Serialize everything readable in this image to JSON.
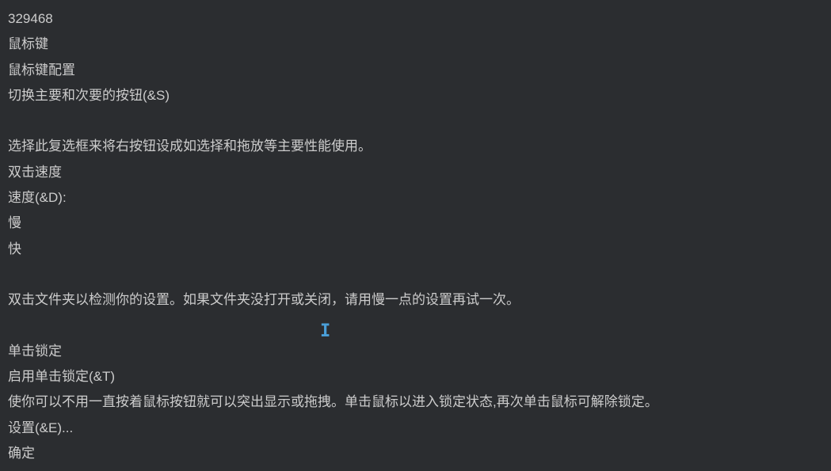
{
  "lines": {
    "title_number": "329468",
    "section_mouse_keys": "鼠标键",
    "section_mouse_keys_config": "鼠标键配置",
    "switch_buttons": "切换主要和次要的按钮(&S)",
    "switch_buttons_desc": "选择此复选框来将右按钮设成如选择和拖放等主要性能使用。",
    "double_click_speed": "双击速度",
    "speed_label": "速度(&D):",
    "speed_slow": "慢",
    "speed_fast": "快",
    "double_click_test": "双击文件夹以检测你的设置。如果文件夹没打开或关闭，请用慢一点的设置再试一次。",
    "click_lock": "单击锁定",
    "enable_click_lock": "启用单击锁定(&T)",
    "click_lock_desc": "使你可以不用一直按着鼠标按钮就可以突出显示或拖拽。单击鼠标以进入锁定状态,再次单击鼠标可解除锁定。",
    "settings_button": "设置(&E)...",
    "ok_button": "确定"
  },
  "cursor_glyph": "I"
}
